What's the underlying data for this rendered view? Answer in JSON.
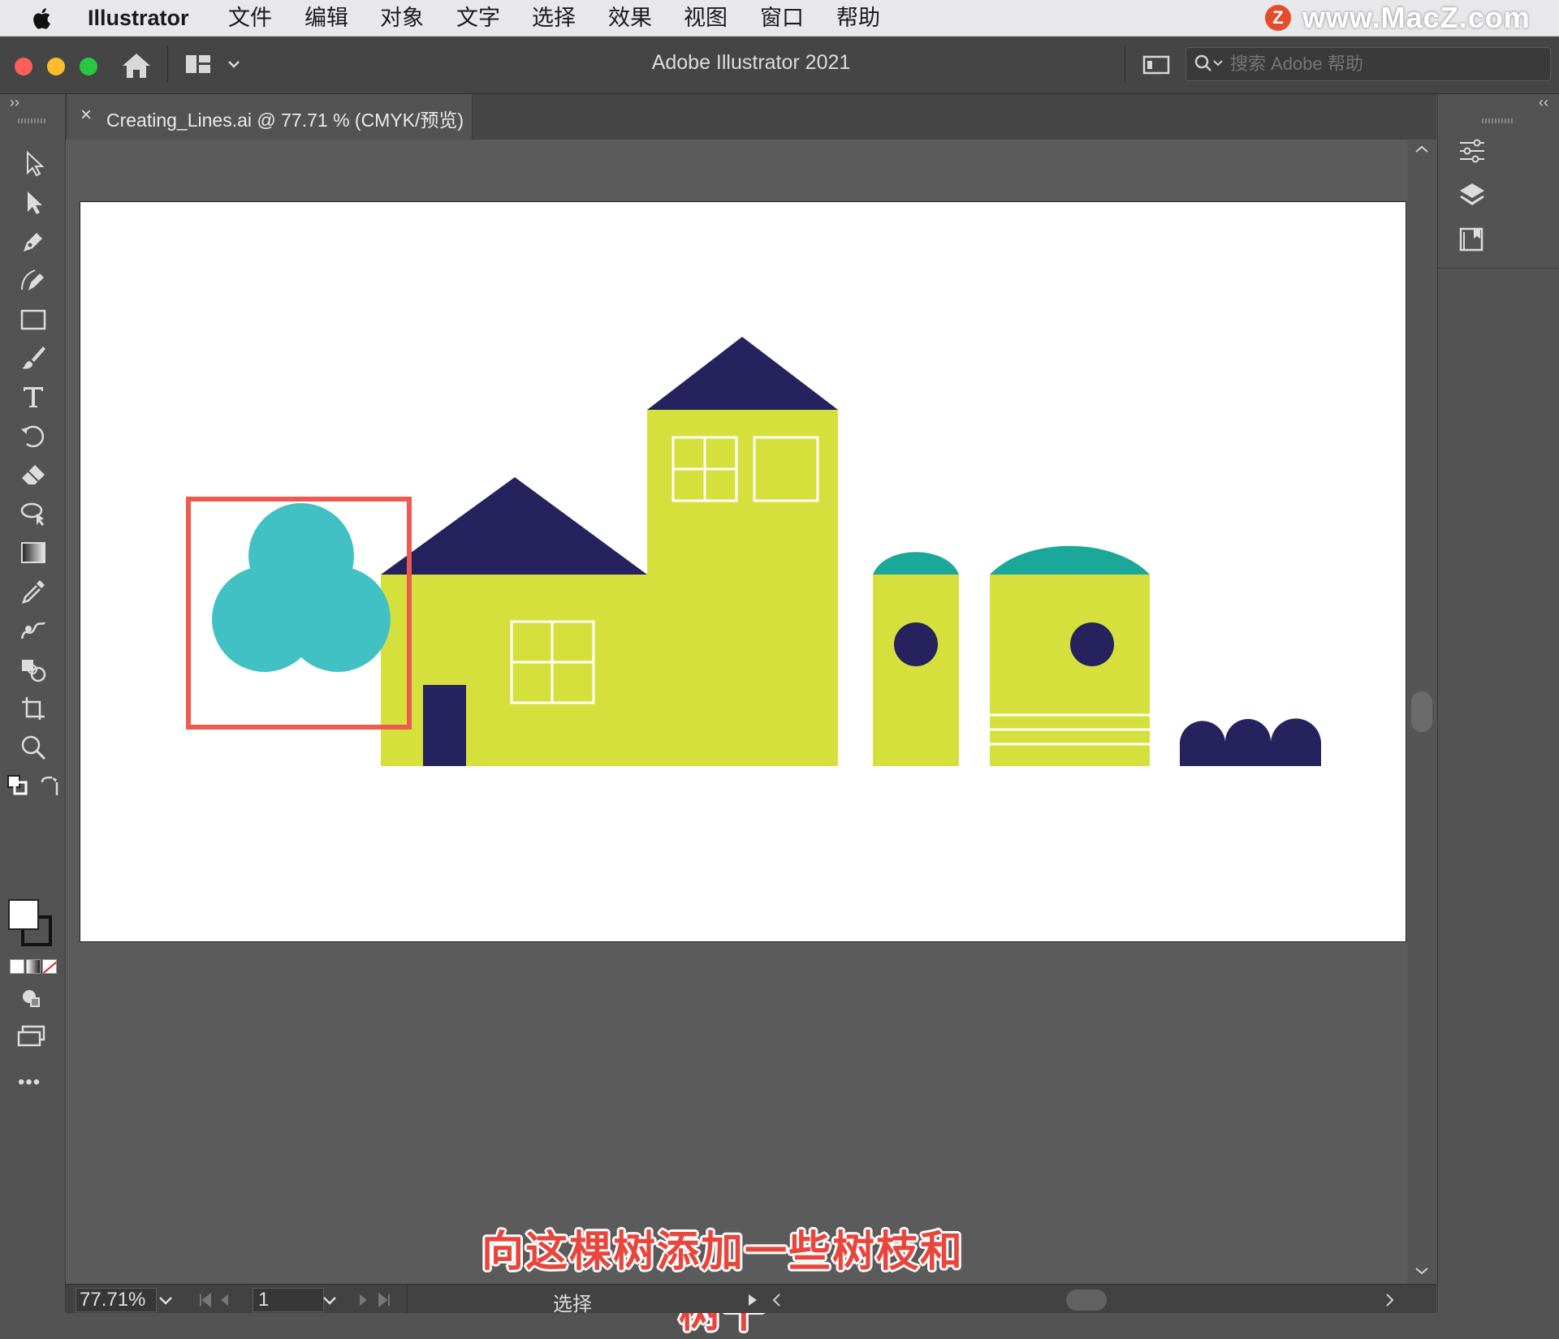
{
  "menubar": {
    "app_name": "Illustrator",
    "items": [
      "文件",
      "编辑",
      "对象",
      "文字",
      "选择",
      "效果",
      "视图",
      "窗口",
      "帮助"
    ]
  },
  "watermark": {
    "logo": "Z",
    "text": "www.MacZ.com"
  },
  "titlebar": {
    "title": "Adobe Illustrator 2021",
    "search_placeholder": "搜索 Adobe 帮助",
    "collapse_left": "››",
    "collapse_right": "‹‹"
  },
  "document_tab": {
    "close": "×",
    "title": "Creating_Lines.ai @ 77.71 % (CMYK/预览)"
  },
  "tools": [
    "selection-tool-icon",
    "direct-selection-tool-icon",
    "pen-tool-icon",
    "curvature-tool-icon",
    "rectangle-tool-icon",
    "paintbrush-tool-icon",
    "type-tool-icon",
    "rotate-tool-icon",
    "eraser-tool-icon",
    "lasso-tool-icon",
    "gradient-tool-icon",
    "eyedropper-tool-icon",
    "blend-tool-icon",
    "shape-builder-tool-icon",
    "artboard-tool-icon",
    "zoom-tool-icon"
  ],
  "toolbar_more": "•••",
  "right_panel_icons": [
    "properties-icon",
    "layers-icon",
    "libraries-icon"
  ],
  "status": {
    "zoom": "77.71%",
    "page": "1",
    "tool": "选择"
  },
  "subtitle": "向这棵树添加一些树枝和树干",
  "colors": {
    "building": "#d5e03c",
    "roof": "#25225e",
    "tree": "#42c1c4",
    "dome": "#1aa89a",
    "highlight": "#ee5a4f"
  }
}
